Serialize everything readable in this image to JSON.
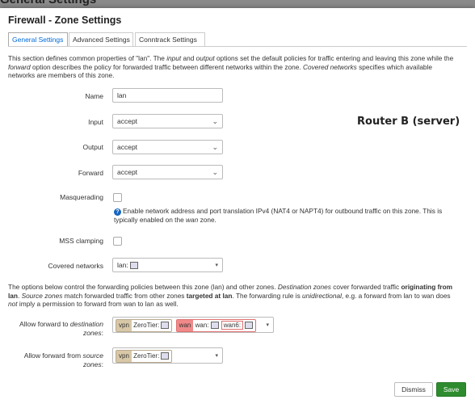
{
  "background": {
    "title": "General Settings"
  },
  "modal": {
    "title": "Firewall - Zone Settings"
  },
  "tabs": [
    {
      "label": "General Settings"
    },
    {
      "label": "Advanced Settings"
    },
    {
      "label": "Conntrack Settings"
    }
  ],
  "intro": {
    "line1": "This section defines common properties of \"lan\". The ",
    "em1": "input",
    "mid1": " and ",
    "em2": "output",
    "line1b": " options set the default policies for traffic entering and leaving this zone while the",
    "em3": "forward",
    "line2": " option describes the policy for forwarded traffic between different networks within the zone. ",
    "em4": "Covered networks",
    "line2b": " specifies which available",
    "line3": "networks are members of this zone."
  },
  "form": {
    "name": {
      "label": "Name",
      "value": "lan"
    },
    "input": {
      "label": "Input",
      "value": "accept"
    },
    "output": {
      "label": "Output",
      "value": "accept"
    },
    "forward": {
      "label": "Forward",
      "value": "accept"
    },
    "masquerading": {
      "label": "Masquerading",
      "help1": "Enable network address and port translation IPv4 (NAT4 or NAPT4) for outbound traffic on this zone. This is",
      "help2a": "typically enabled on the ",
      "help2em": "wan",
      "help2b": " zone."
    },
    "mss": {
      "label": "MSS clamping"
    },
    "covered": {
      "label": "Covered networks",
      "value": "lan:"
    }
  },
  "annotation": "Router B (server)",
  "forwarding_intro": {
    "a": "The options below control the forwarding policies between this zone (lan) and other zones. ",
    "em1": "Destination zones",
    "b": " cover forwarded traffic ",
    "strong1": "originating from",
    "c_strong": "lan",
    "c": ". ",
    "em2": "Source zones",
    "d": " match forwarded traffic from other zones ",
    "strong2": "targeted at lan",
    "e": ". The forwarding rule is ",
    "em3": "unidirectional",
    "f": ", e.g. a forward from lan to wan does",
    "em4": "not",
    "g": " imply a permission to forward from wan to lan as well."
  },
  "forward_to": {
    "label1": "Allow forward to ",
    "label_em": "destination",
    "label2": "zones",
    "zones": [
      {
        "zone": "vpn",
        "networks": [
          "ZeroTier:"
        ],
        "color": "#d8c8a8"
      },
      {
        "zone": "wan",
        "networks": [
          "wan:",
          "wan6:"
        ],
        "color": "#f08a8a"
      }
    ]
  },
  "forward_from": {
    "label1": "Allow forward from ",
    "label_em": "source",
    "label2": "zones",
    "zones": [
      {
        "zone": "vpn",
        "networks": [
          "ZeroTier:"
        ],
        "color": "#d8c8a8"
      }
    ]
  },
  "buttons": {
    "dismiss": "Dismiss",
    "save": "Save"
  },
  "colors": {
    "accent": "#0069d6",
    "save": "#2e8b2e"
  }
}
